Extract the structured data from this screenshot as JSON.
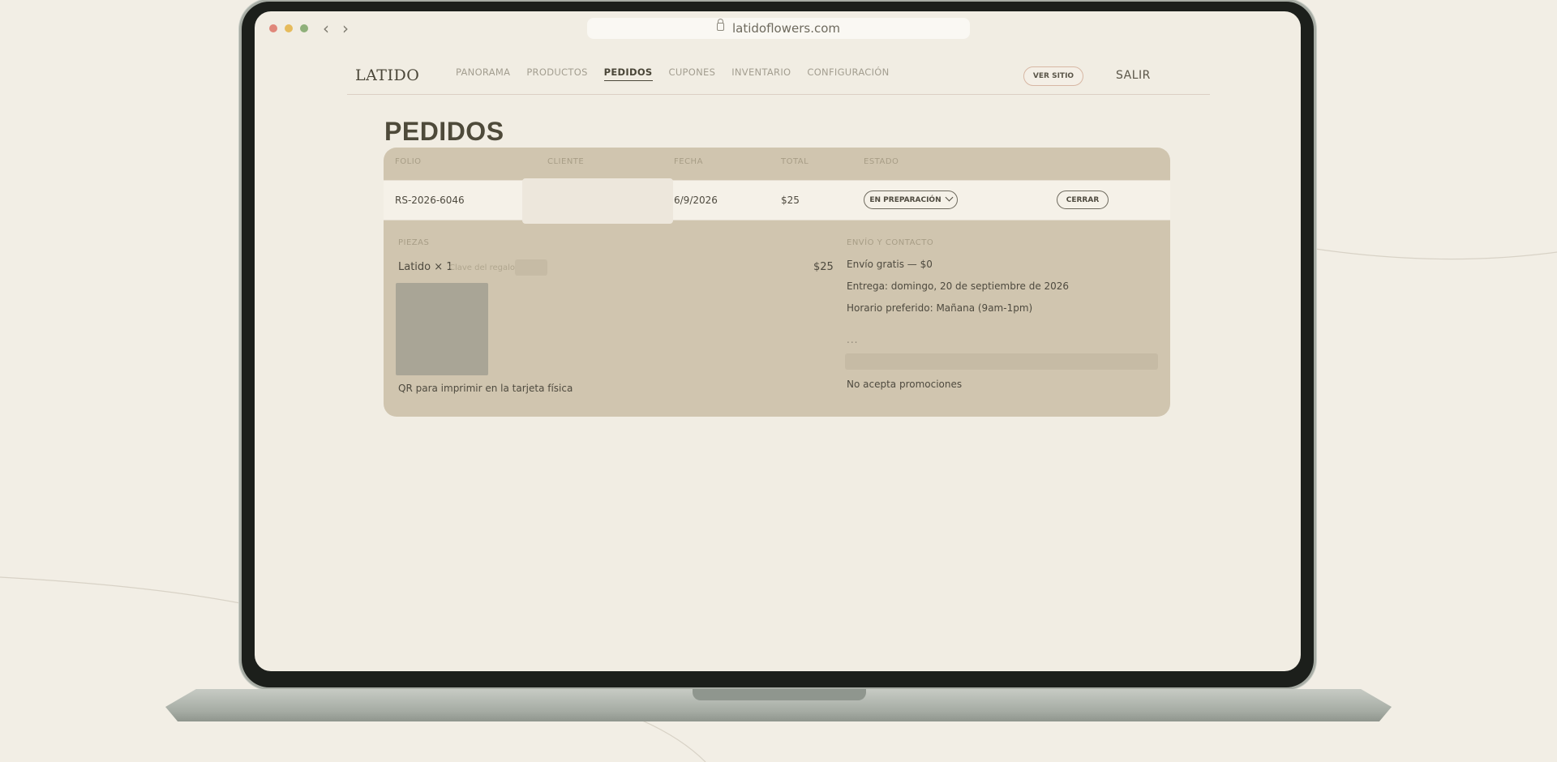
{
  "browser": {
    "url": "latidoflowers.com",
    "back_icon": "chevron-left-icon",
    "forward_icon": "chevron-right-icon"
  },
  "header": {
    "brand": "LATIDO",
    "nav": [
      {
        "label": "PANORAMA",
        "active": false
      },
      {
        "label": "PRODUCTOS",
        "active": false
      },
      {
        "label": "PEDIDOS",
        "active": true
      },
      {
        "label": "CUPONES",
        "active": false
      },
      {
        "label": "INVENTARIO",
        "active": false
      },
      {
        "label": "CONFIGURACIÓN",
        "active": false
      }
    ],
    "ver_sitio": "VER SITIO",
    "salir": "SALIR"
  },
  "page": {
    "title": "PEDIDOS"
  },
  "orders": {
    "columns": [
      "FOLIO",
      "CLIENTE",
      "FECHA",
      "TOTAL",
      "ESTADO"
    ],
    "row": {
      "folio": "RS-2026-6046",
      "fecha": "6/9/2026",
      "total": "$25",
      "estado": "EN PREPARACIÓN",
      "cerrar": "CERRAR"
    },
    "detail": {
      "piezas_label": "PIEZAS",
      "item_name": "Latido × 1",
      "gift_key_label": "Clave del regalo",
      "item_price": "$25",
      "qr_caption": "QR para imprimir en la tarjeta física",
      "envio_label": "ENVÍO Y CONTACTO",
      "envio": "Envío gratis — $0",
      "entrega": "Entrega: domingo, 20 de septiembre de 2026",
      "horario": "Horario preferido: Mañana (9am-1pm)",
      "ellipsis": "...",
      "promos": "No acepta promociones"
    }
  },
  "colors": {
    "background": "#f2eee5",
    "card": "#d0c5af",
    "accent_border": "#d7b7a4",
    "text": "#4a4638"
  }
}
